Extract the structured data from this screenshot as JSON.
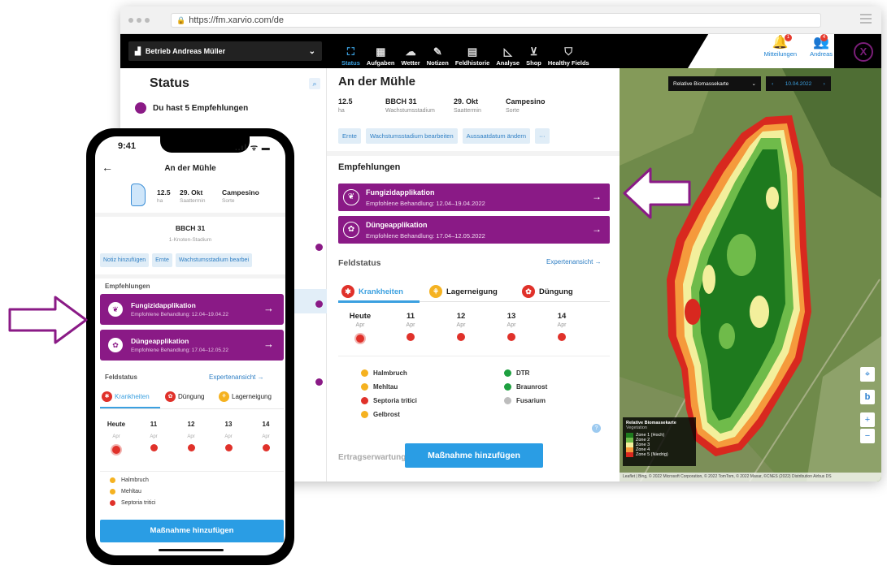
{
  "browser": {
    "url": "https://fm.xarvio.com/de"
  },
  "header": {
    "farm": "Betrieb Andreas Müller",
    "nav": [
      {
        "icon": "status-icon",
        "label": "Status",
        "active": true
      },
      {
        "icon": "tasks-icon",
        "label": "Aufgaben"
      },
      {
        "icon": "weather-icon",
        "label": "Wetter"
      },
      {
        "icon": "notes-icon",
        "label": "Notizen"
      },
      {
        "icon": "history-icon",
        "label": "Feldhistorie"
      },
      {
        "icon": "analysis-icon",
        "label": "Analyse"
      },
      {
        "icon": "cart-icon",
        "label": "Shop"
      },
      {
        "icon": "shield-icon",
        "label": "Healthy Fields"
      }
    ],
    "notifications": {
      "label": "Mitteilungen",
      "count": "1"
    },
    "user": {
      "label": "Andreas",
      "count": "4"
    },
    "logo": "X"
  },
  "left": {
    "title": "Status",
    "rec_text": "Du hast 5 Empfehlungen"
  },
  "field": {
    "name": "An der Mühle",
    "area": "12.5",
    "area_unit": "ha",
    "bbch": "BBCH 31",
    "bbch_label": "Wachstumsstadium",
    "sow_date": "29. Okt",
    "sow_label": "Saattermin",
    "variety": "Campesino",
    "variety_label": "Sorte",
    "chips": [
      "Ernte",
      "Wachstumsstadium bearbeiten",
      "Aussaatdatum ändern",
      "···"
    ],
    "recs_title": "Empfehlungen",
    "recs": [
      {
        "title": "Fungizidapplikation",
        "sub": "Empfohlene Behandlung: 12.04–19.04.2022",
        "arrow": "→"
      },
      {
        "title": "Düngeapplikation",
        "sub": "Empfohlene Behandlung: 17.04–12.05.2022",
        "arrow": "→"
      }
    ],
    "status_title": "Feldstatus",
    "expert": "Expertenansicht →",
    "tabs": [
      "Krankheiten",
      "Lagerneigung",
      "Düngung"
    ],
    "days": [
      {
        "d": "Heute",
        "m": "Apr"
      },
      {
        "d": "11",
        "m": "Apr"
      },
      {
        "d": "12",
        "m": "Apr"
      },
      {
        "d": "13",
        "m": "Apr"
      },
      {
        "d": "14",
        "m": "Apr"
      }
    ],
    "diseases": [
      {
        "name": "Halmbruch",
        "color": "#f5b221"
      },
      {
        "name": "Mehltau",
        "color": "#f5b221"
      },
      {
        "name": "Septoria tritici",
        "color": "#e0312a"
      },
      {
        "name": "Gelbrost",
        "color": "#f5b221"
      },
      {
        "name": "DTR",
        "color": "#1ea040"
      },
      {
        "name": "Braunrost",
        "color": "#1ea040"
      },
      {
        "name": "Fusarium",
        "color": "#bdbdbd"
      }
    ],
    "ertrag": "Ertragserwartung",
    "add_action": "Maßnahme hinzufügen"
  },
  "map": {
    "layer": "Relative Biomassekarte",
    "date": "10.04.2022",
    "legend_title": "Relative Biomassekarte",
    "legend_sub": "Vegetation",
    "zones": [
      {
        "label": "Zone 1 (Hoch)",
        "color": "#1e7a1e"
      },
      {
        "label": "Zone 2",
        "color": "#6fbb4a"
      },
      {
        "label": "Zone 3",
        "color": "#f3ef9c"
      },
      {
        "label": "Zone 4",
        "color": "#f59a3c"
      },
      {
        "label": "Zone 5 (Niedrig)",
        "color": "#d8281f"
      }
    ],
    "attribution": "Leaflet | Bing, © 2022 Microsoft Corporation, © 2022 TomTom, © 2022 Maxar, ©CNES (2022) Distribution Airbus DS"
  },
  "phone": {
    "time": "9:41",
    "status_icons": "..ıl ᯤ ▬",
    "title": "An der Mühle",
    "area": "12.5",
    "area_unit": "ha",
    "sow_date": "29. Okt",
    "sow_label": "Saattermin",
    "variety": "Campesino",
    "variety_label": "Sorte",
    "bbch": "BBCH 31",
    "bbch_label": "1-Knoten-Stadium",
    "chips": [
      "Notiz hinzufügen",
      "Ernte",
      "Wachstumsstadium bearbei"
    ],
    "recs_title": "Empfehlungen",
    "recs": [
      {
        "title": "Fungizidapplikation",
        "sub": "Empfohlene Behandlung: 12.04–19.04.22"
      },
      {
        "title": "Düngeapplikation",
        "sub": "Empfohlene Behandlung: 17.04–12.05.22"
      }
    ],
    "status_title": "Feldstatus",
    "expert": "Expertenansicht →",
    "tabs": [
      "Krankheiten",
      "Düngung",
      "Lagerneigung"
    ],
    "days": [
      {
        "d": "Heute",
        "m": "Apr"
      },
      {
        "d": "11",
        "m": "Apr"
      },
      {
        "d": "12",
        "m": "Apr"
      },
      {
        "d": "13",
        "m": "Apr"
      },
      {
        "d": "14",
        "m": "Apr"
      }
    ],
    "diseases": [
      {
        "name": "Halmbruch",
        "color": "#f5b221"
      },
      {
        "name": "Mehltau",
        "color": "#f5b221"
      },
      {
        "name": "Septoria tritici",
        "color": "#e0312a"
      }
    ],
    "add_action": "Maßnahme hinzufügen"
  },
  "colors": {
    "purple": "#8a1a86",
    "blue": "#2a9de4",
    "red": "#e0312a"
  }
}
